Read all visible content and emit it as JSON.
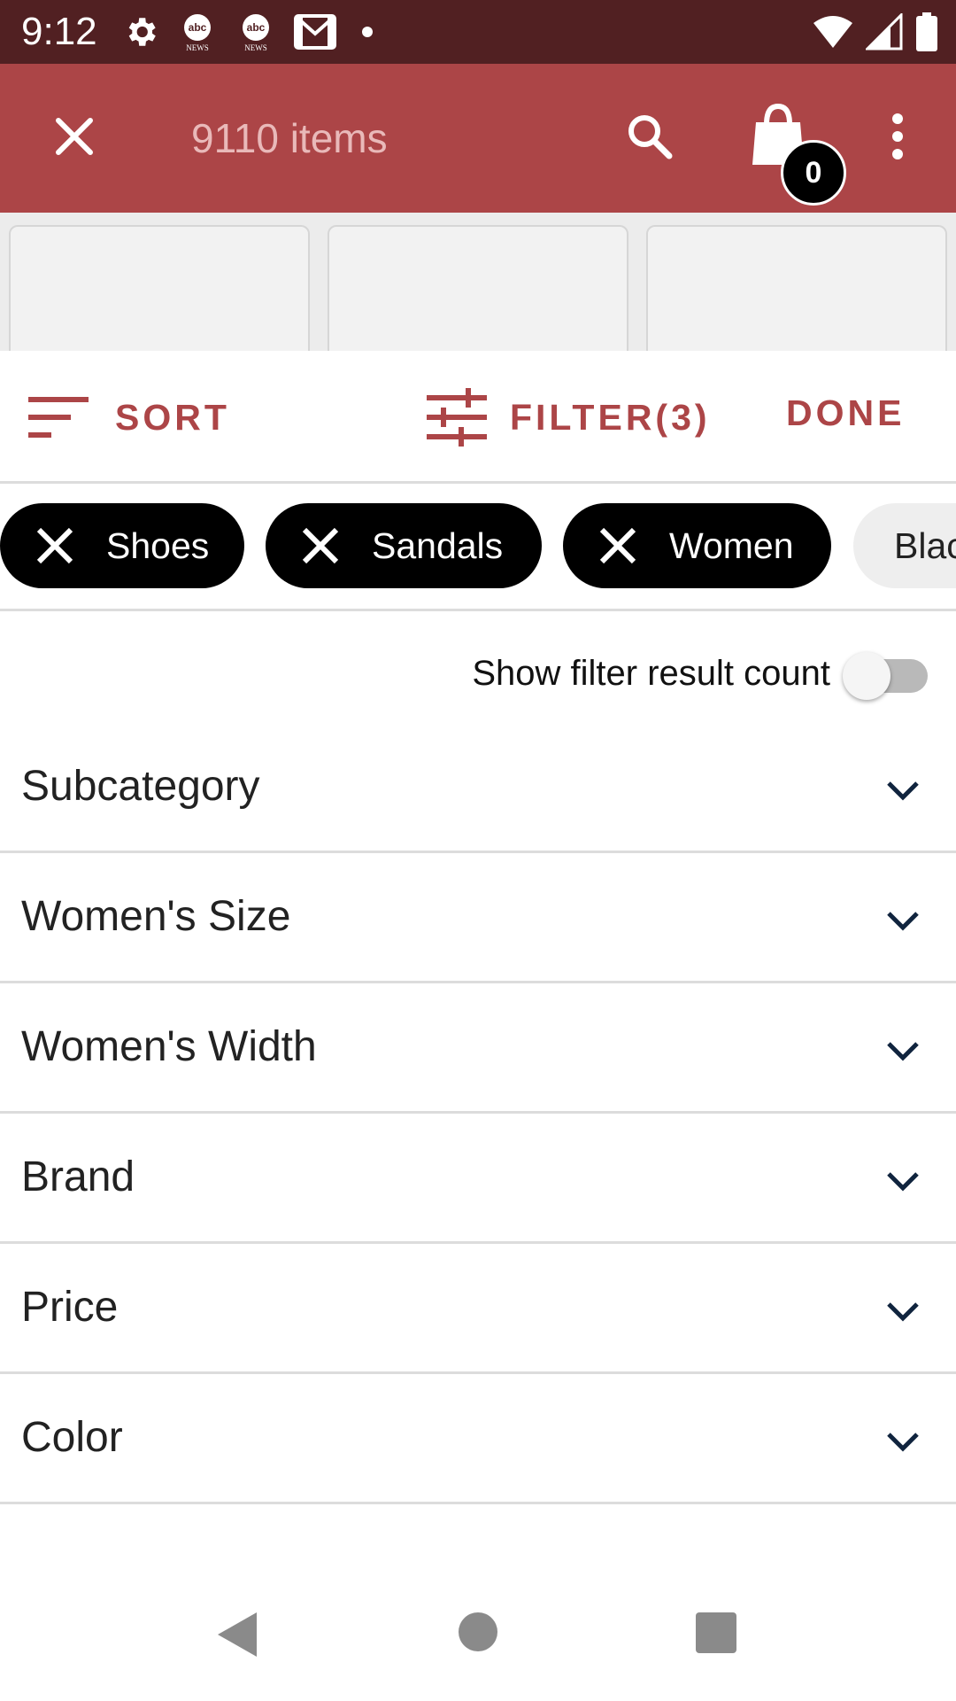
{
  "status_bar": {
    "time": "9:12",
    "background": "#512022",
    "left_icons": [
      "settings-gear-icon",
      "abc-news-icon",
      "abc-news-icon",
      "gmail-icon",
      "notification-dot-icon"
    ],
    "right_icons": [
      "wifi-icon",
      "cell-signal-icon",
      "battery-icon"
    ],
    "abc_news_caption": "NEWS"
  },
  "app_bar": {
    "title": "9110 items",
    "background": "#ac4547",
    "bag_count": "0",
    "icons": [
      "close-icon",
      "search-icon",
      "shopping-bag-icon",
      "more-vert-icon"
    ]
  },
  "actions": {
    "sort_label": "SORT",
    "filter_label": "FILTER(3)",
    "done_label": "DONE",
    "accent": "#ac4547"
  },
  "chips": [
    {
      "label": "Shoes",
      "removable": true
    },
    {
      "label": "Sandals",
      "removable": true
    },
    {
      "label": "Women",
      "removable": true
    },
    {
      "label": "Blac",
      "removable": false
    }
  ],
  "toggle": {
    "label": "Show filter result count",
    "on": false
  },
  "facets": [
    {
      "label": "Subcategory"
    },
    {
      "label": "Women's Size"
    },
    {
      "label": "Women's Width"
    },
    {
      "label": "Brand"
    },
    {
      "label": "Price"
    },
    {
      "label": "Color"
    },
    {
      "label": ""
    }
  ],
  "nav_bar": {
    "icons": [
      "back-icon",
      "home-icon",
      "recent-apps-icon"
    ]
  }
}
